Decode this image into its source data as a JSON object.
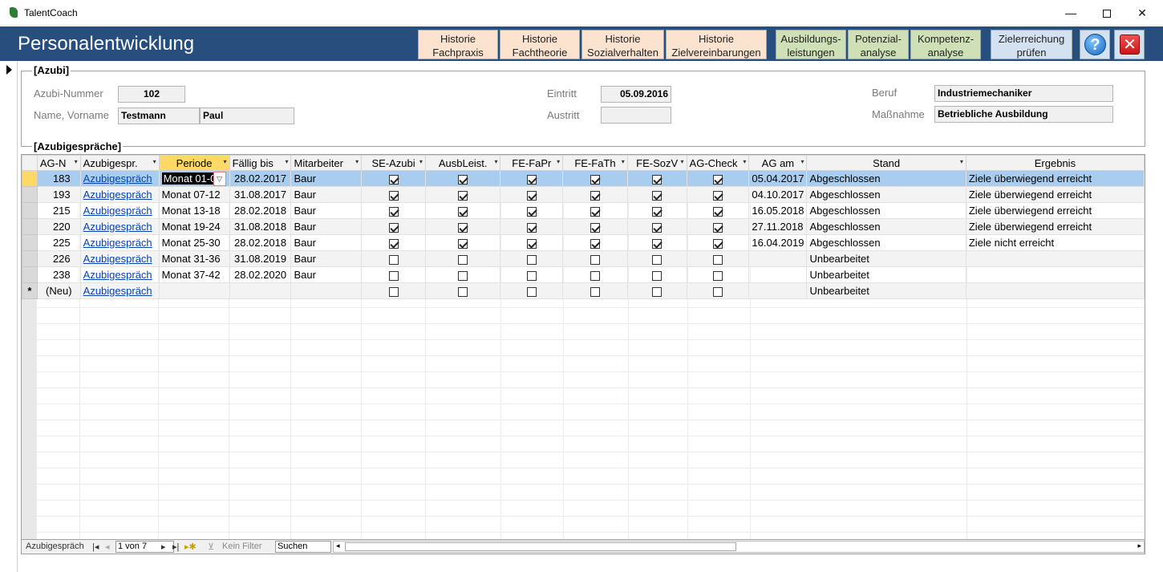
{
  "window": {
    "title": "TalentCoach",
    "minimize": "—",
    "close": "✕"
  },
  "header": {
    "heading": "Personalentwicklung",
    "buttons": [
      {
        "line1": "Historie",
        "line2": "Fachpraxis"
      },
      {
        "line1": "Historie",
        "line2": "Fachtheorie"
      },
      {
        "line1": "Historie",
        "line2": "Sozialverhalten"
      },
      {
        "line1": "Historie",
        "line2": "Zielvereinbarungen"
      },
      {
        "line1": "Ausbildungs-",
        "line2": "leistungen"
      },
      {
        "line1": "Potenzial-",
        "line2": "analyse"
      },
      {
        "line1": "Kompetenz-",
        "line2": "analyse"
      },
      {
        "line1": "Zielerreichung",
        "line2": "prüfen"
      }
    ],
    "help_glyph": "?",
    "close_glyph": "✕",
    "colors": {
      "band": "#274e7d",
      "peach": "#fbe3cf",
      "green": "#cfe0b6",
      "blue": "#d4e1f0"
    }
  },
  "azubi": {
    "group_title": "[Azubi]",
    "labels": {
      "nummer": "Azubi-Nummer",
      "name": "Name, Vorname",
      "eintritt": "Eintritt",
      "austritt": "Austritt",
      "beruf": "Beruf",
      "massnahme": "Maßnahme"
    },
    "values": {
      "nummer": "102",
      "nachname": "Testmann",
      "vorname": "Paul",
      "eintritt": "05.09.2016",
      "austritt": "",
      "beruf": "Industriemechaniker",
      "massnahme": "Betriebliche Ausbildung"
    }
  },
  "gespraeche": {
    "group_title": "[Azubigespräche]",
    "columns": [
      "AG-N",
      "Azubigespr.",
      "Periode",
      "Fällig bis",
      "Mitarbeiter",
      "SE-Azubi",
      "AusbLeist.",
      "FE-FaPr",
      "FE-FaTh",
      "FE-SozV",
      "AG-Check",
      "AG am",
      "Stand",
      "Ergebnis"
    ],
    "rows": [
      {
        "nr": "183",
        "link": "Azubigespräch",
        "periode": "Monat 01-06",
        "faellig": "28.02.2017",
        "ma": "Baur",
        "c": [
          true,
          true,
          true,
          true,
          true,
          true
        ],
        "am": "05.04.2017",
        "stand": "Abgeschlossen",
        "ergebnis": "Ziele überwiegend erreicht"
      },
      {
        "nr": "193",
        "link": "Azubigespräch",
        "periode": "Monat 07-12",
        "faellig": "31.08.2017",
        "ma": "Baur",
        "c": [
          true,
          true,
          true,
          true,
          true,
          true
        ],
        "am": "04.10.2017",
        "stand": "Abgeschlossen",
        "ergebnis": "Ziele überwiegend erreicht"
      },
      {
        "nr": "215",
        "link": "Azubigespräch",
        "periode": "Monat 13-18",
        "faellig": "28.02.2018",
        "ma": "Baur",
        "c": [
          true,
          true,
          true,
          true,
          true,
          true
        ],
        "am": "16.05.2018",
        "stand": "Abgeschlossen",
        "ergebnis": "Ziele überwiegend erreicht"
      },
      {
        "nr": "220",
        "link": "Azubigespräch",
        "periode": "Monat 19-24",
        "faellig": "31.08.2018",
        "ma": "Baur",
        "c": [
          true,
          true,
          true,
          true,
          true,
          true
        ],
        "am": "27.11.2018",
        "stand": "Abgeschlossen",
        "ergebnis": "Ziele überwiegend erreicht"
      },
      {
        "nr": "225",
        "link": "Azubigespräch",
        "periode": "Monat 25-30",
        "faellig": "28.02.2018",
        "ma": "Baur",
        "c": [
          true,
          true,
          true,
          true,
          true,
          true
        ],
        "am": "16.04.2019",
        "stand": "Abgeschlossen",
        "ergebnis": "Ziele nicht erreicht"
      },
      {
        "nr": "226",
        "link": "Azubigespräch",
        "periode": "Monat 31-36",
        "faellig": "31.08.2019",
        "ma": "Baur",
        "c": [
          false,
          false,
          false,
          false,
          false,
          false
        ],
        "am": "",
        "stand": "Unbearbeitet",
        "ergebnis": ""
      },
      {
        "nr": "238",
        "link": "Azubigespräch",
        "periode": "Monat 37-42",
        "faellig": "28.02.2020",
        "ma": "Baur",
        "c": [
          false,
          false,
          false,
          false,
          false,
          false
        ],
        "am": "",
        "stand": "Unbearbeitet",
        "ergebnis": ""
      }
    ],
    "new_row": {
      "marker": "*",
      "nr": "(Neu)",
      "link": "Azubigespräch",
      "stand": "Unbearbeitet"
    }
  },
  "navbar": {
    "label": "Azubigespräch",
    "first": "|◂",
    "prev": "◂",
    "record": "1 von 7",
    "next": "▸",
    "last": "▸|",
    "new": "▸✱",
    "filter": "Kein Filter",
    "search": "Suchen"
  }
}
